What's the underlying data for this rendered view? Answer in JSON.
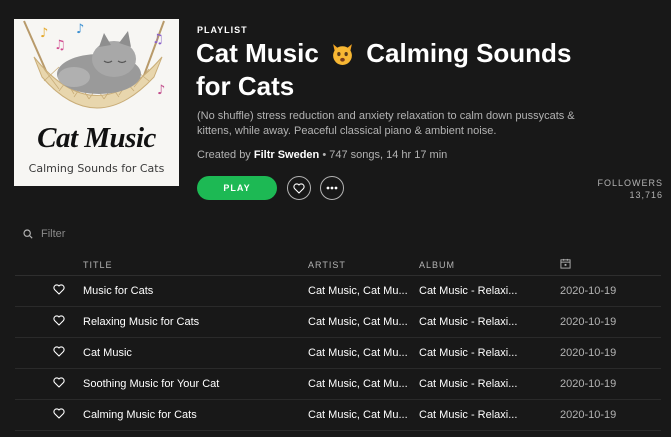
{
  "cover": {
    "title": "Cat Music",
    "subtitle": "Calming Sounds for Cats"
  },
  "playlist": {
    "kind_label": "PLAYLIST",
    "title_part1": "Cat Music",
    "title_emoji": "cat-face",
    "title_part2": "Calming Sounds",
    "title_line2": "for Cats",
    "description": "(No shuffle) stress reduction and anxiety relaxation to calm down pussycats & kittens, while away. Peaceful classical piano & ambient noise.",
    "created_by_label": "Created by",
    "owner": "Filtr Sweden",
    "stats": "• 747 songs, 14 hr 17 min"
  },
  "actions": {
    "play_label": "PLAY",
    "followers_label": "FOLLOWERS",
    "followers_count": "13,716"
  },
  "filter": {
    "placeholder": "Filter"
  },
  "columns": {
    "title": "TITLE",
    "artist": "ARTIST",
    "album": "ALBUM",
    "date_icon": "calendar-icon"
  },
  "tracks": [
    {
      "title": "Music for Cats",
      "artist": "Cat Music, Cat Mu...",
      "album": "Cat Music - Relaxi...",
      "date": "2020-10-19"
    },
    {
      "title": "Relaxing Music for Cats",
      "artist": "Cat Music, Cat Mu...",
      "album": "Cat Music - Relaxi...",
      "date": "2020-10-19"
    },
    {
      "title": "Cat Music",
      "artist": "Cat Music, Cat Mu...",
      "album": "Cat Music - Relaxi...",
      "date": "2020-10-19"
    },
    {
      "title": "Soothing Music for Your Cat",
      "artist": "Cat Music, Cat Mu...",
      "album": "Cat Music - Relaxi...",
      "date": "2020-10-19"
    },
    {
      "title": "Calming Music for Cats",
      "artist": "Cat Music, Cat Mu...",
      "album": "Cat Music - Relaxi...",
      "date": "2020-10-19"
    }
  ],
  "colors": {
    "background": "#181818",
    "accent": "#1db954",
    "muted_text": "#b3b3b3"
  }
}
